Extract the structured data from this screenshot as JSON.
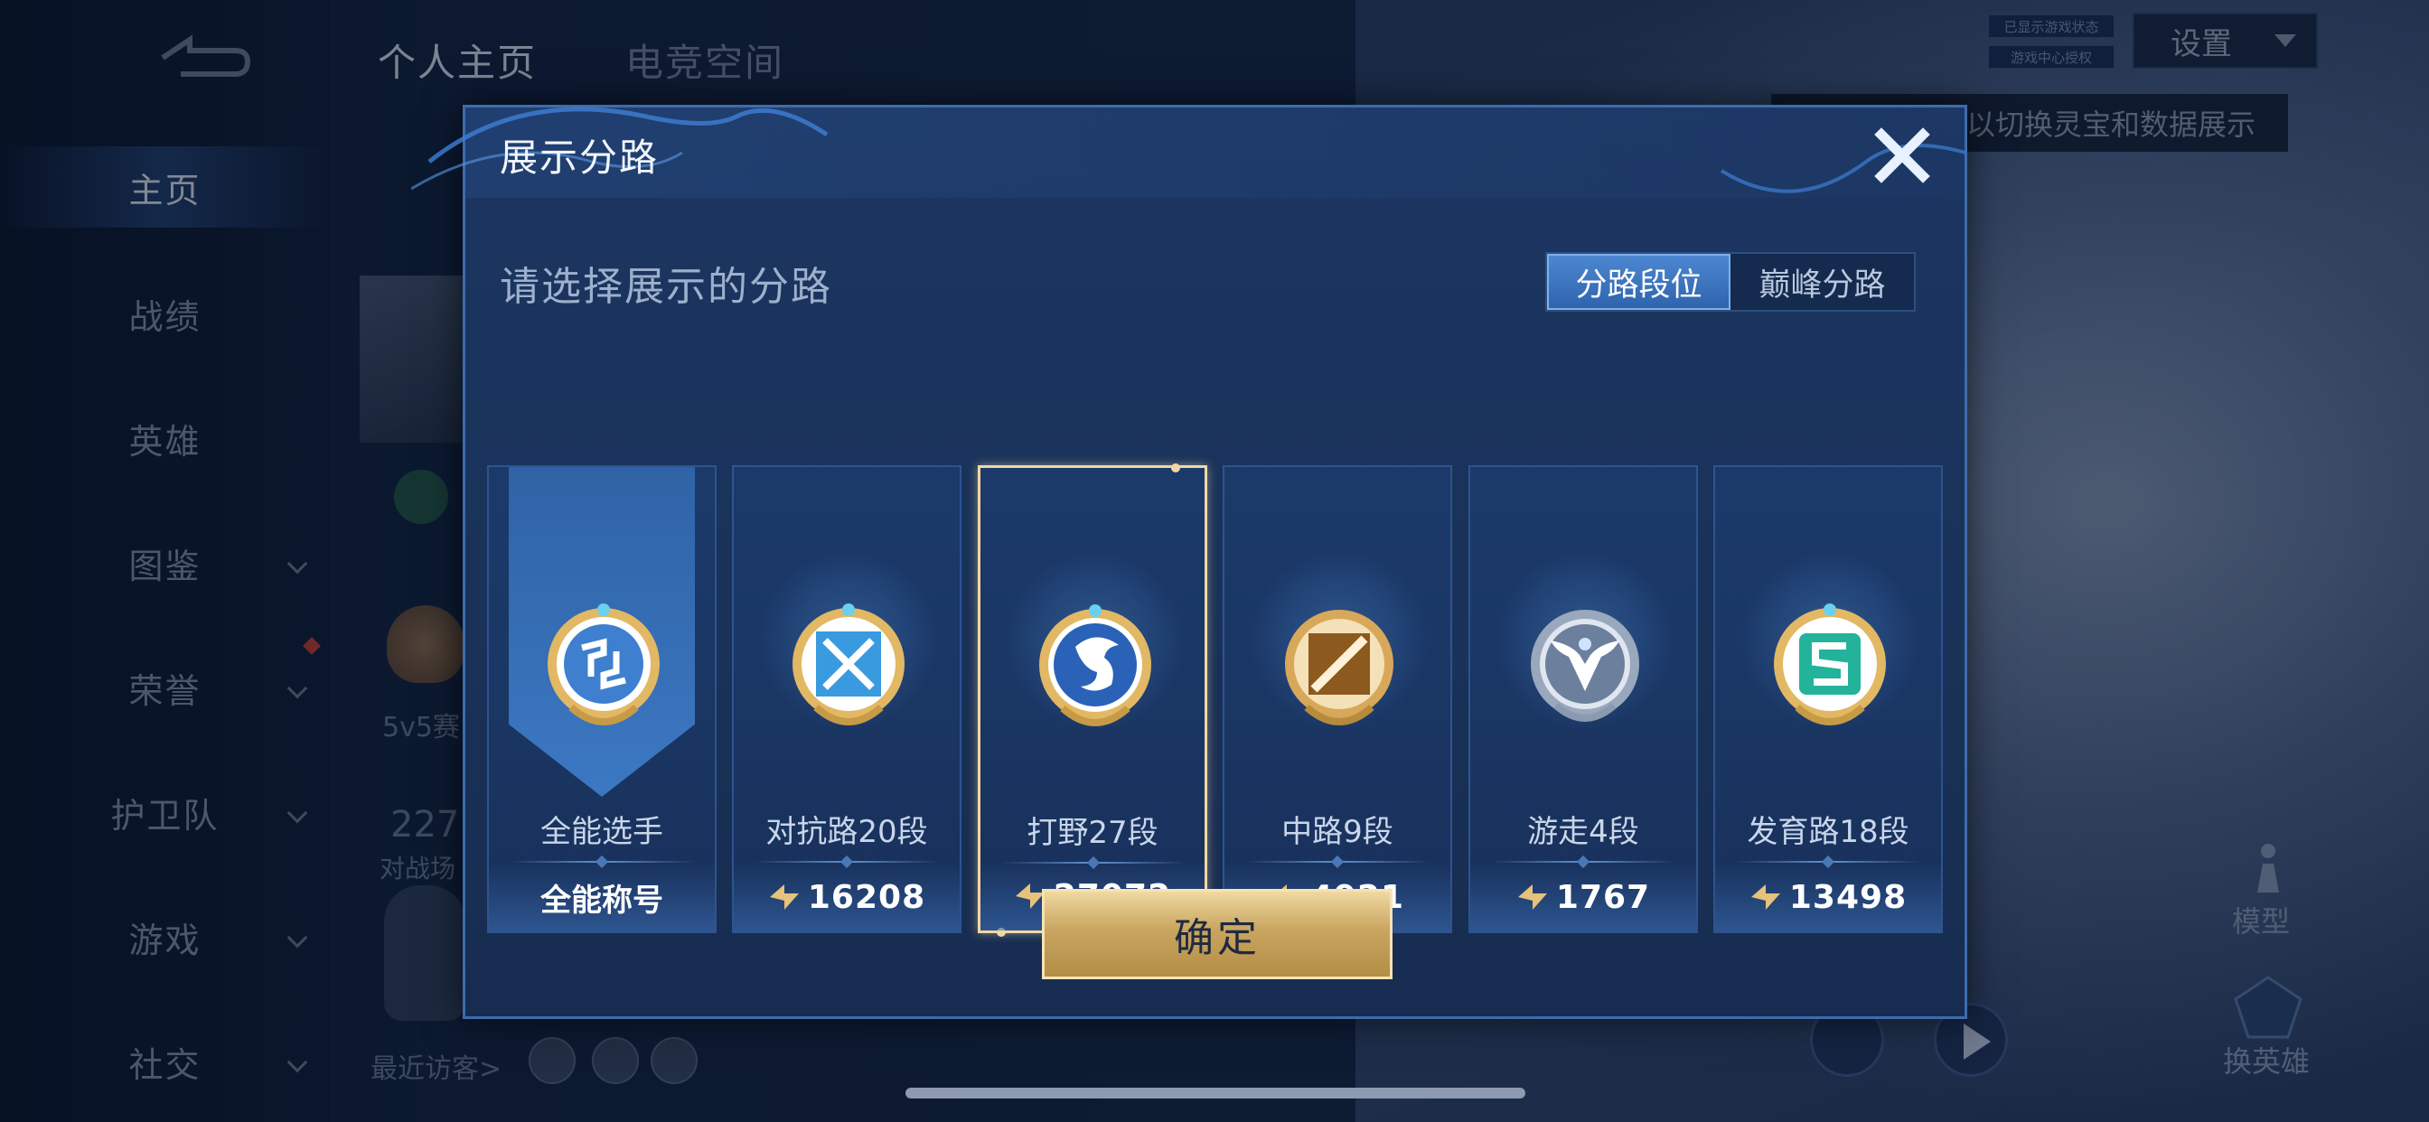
{
  "nav": {
    "items": [
      {
        "label": "主页",
        "active": true
      },
      {
        "label": "战绩"
      },
      {
        "label": "英雄"
      },
      {
        "label": "图鉴"
      },
      {
        "label": "荣誉"
      },
      {
        "label": "护卫队"
      },
      {
        "label": "游戏"
      },
      {
        "label": "社交"
      }
    ]
  },
  "top_tabs": [
    "个人主页",
    "电竞空间"
  ],
  "settings_label": "设置",
  "badges": [
    "已显示游戏状态",
    "游戏中心授权"
  ],
  "tip_text": "以切换灵宝和数据展示",
  "profile": {
    "mode_text": "5v5赛",
    "count_text": "2271",
    "count_label": "对战场",
    "visitors_label": "最近访客>"
  },
  "side": {
    "model_label": "模型",
    "swap_label": "换英雄"
  },
  "modal": {
    "title": "展示分路",
    "subtitle": "请选择展示的分路",
    "segments": [
      {
        "label": "分路段位",
        "active": true
      },
      {
        "label": "巅峰分路",
        "active": false
      }
    ],
    "cards": [
      {
        "name": "全能选手",
        "value": "全能称号",
        "icon": "all-round-emblem-icon",
        "color": "#3f7fd0"
      },
      {
        "name": "对抗路20段",
        "value": "16208",
        "icon": "clash-lane-emblem-icon",
        "color": "#3a9ae0"
      },
      {
        "name": "打野27段",
        "value": "27072",
        "icon": "jungle-dragon-emblem-icon",
        "color": "#2a62b8",
        "selected": true
      },
      {
        "name": "中路9段",
        "value": "4921",
        "icon": "mid-lane-emblem-icon",
        "color": "#b07a2e"
      },
      {
        "name": "游走4段",
        "value": "1767",
        "icon": "roam-wings-emblem-icon",
        "color": "#6c7f9c"
      },
      {
        "name": "发育路18段",
        "value": "13498",
        "icon": "farm-lane-emblem-icon",
        "color": "#22b39a"
      }
    ],
    "confirm_label": "确定",
    "accent_gold": "#c9a560"
  }
}
